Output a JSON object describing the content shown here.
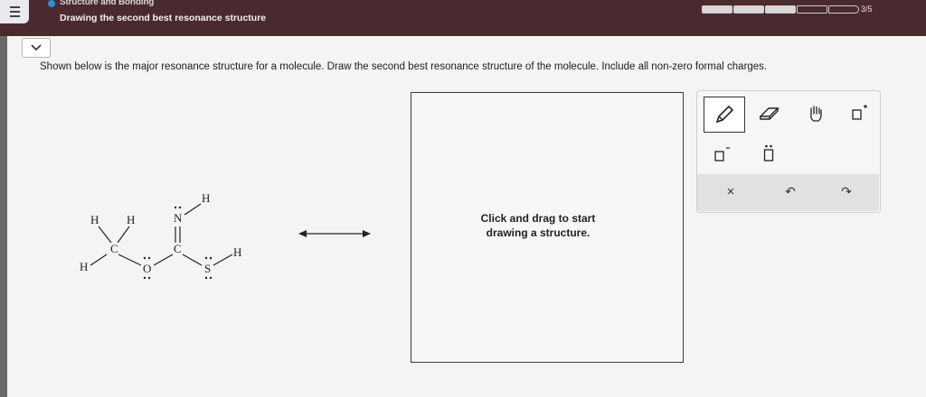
{
  "header": {
    "topic": "Structure and Bonding",
    "title": "Drawing the second best resonance structure",
    "progress_text": "3/5",
    "progress_filled": 3,
    "progress_total": 5
  },
  "question": {
    "text": "Shown below is the major resonance structure for a molecule. Draw the second best resonance structure of the molecule. Include all non-zero formal charges."
  },
  "molecule": {
    "atoms": {
      "h1": "H",
      "h2": "H",
      "h3": "H",
      "h4": "H",
      "h5": "H",
      "c1": "C",
      "c2": "C",
      "o": "O",
      "n": "N",
      "s": "S"
    }
  },
  "canvas": {
    "hint": "Click and drag to start drawing a structure."
  },
  "toolbar": {
    "tools": [
      "pencil-icon",
      "eraser-icon",
      "hand-icon",
      "positive-charge-icon",
      "negative-charge-icon",
      "lone-pair-icon"
    ],
    "actions": {
      "clear": "×",
      "undo": "↶",
      "redo": "↷"
    }
  }
}
